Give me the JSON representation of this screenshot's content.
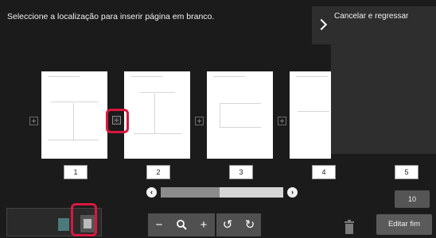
{
  "instruction": "Seleccione a localização para inserir página em branco.",
  "side_panel": {
    "title": "Cancelar e regressar",
    "toggle_icon": "chevron-right-icon"
  },
  "pages": [
    {
      "number": "1"
    },
    {
      "number": "2"
    },
    {
      "number": "3"
    },
    {
      "number": "4"
    },
    {
      "number": "5"
    }
  ],
  "page_count_button": "10",
  "toolbar": {
    "zoom_out_icon": "minus-icon",
    "zoom_icon": "magnifier-icon",
    "zoom_in_icon": "plus-icon",
    "rotate_left_icon": "rotate-left-icon",
    "rotate_right_icon": "rotate-right-icon",
    "delete_icon": "trash-icon"
  },
  "finish_button": "Editar fim",
  "colors": {
    "highlight": "#d8183f",
    "background": "#1b1b1b",
    "panel": "#2e2e2e"
  }
}
